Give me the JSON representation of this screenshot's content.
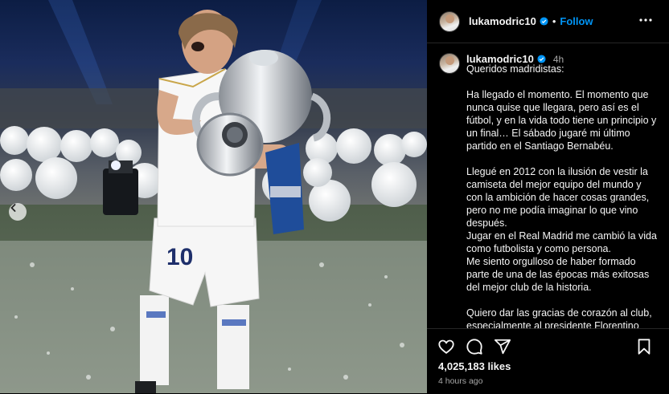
{
  "post": {
    "username": "lukamodric10",
    "follow_label": "Follow",
    "caption_time": "4h",
    "caption": "Queridos madridistas:\n\nHa llegado el momento. El momento que nunca quise que llegara, pero así es el fútbol, y en la vida todo tiene un principio y un final… El sábado jugaré mi último partido en el Santiago Bernabéu.\n\nLlegué en 2012 con la ilusión de vestir la camiseta del mejor equipo del mundo y con la ambición de hacer cosas grandes, pero no me podía imaginar lo que vino después.\nJugar en el Real Madrid me cambió la vida como futbolista y como persona.\nMe siento orgulloso de haber formado parte de una de las épocas más exitosas del mejor club de la historia.\n\nQuiero dar las gracias de corazón al club, especialmente al presidente Florentino",
    "likes": "4,025,183 likes",
    "posted_ago": "4 hours ago"
  },
  "photo": {
    "shirt_number": "10"
  },
  "colors": {
    "background": "#000000",
    "link_blue": "#0095f6",
    "verified_blue": "#0095f6",
    "muted_text": "#a8a8a8",
    "divider": "#262626"
  },
  "icons": {
    "verified": "verified-badge-icon",
    "more": "more-options-icon",
    "like": "heart-icon",
    "comment": "comment-icon",
    "share": "send-icon",
    "save": "bookmark-icon",
    "prev": "chevron-left-icon"
  }
}
